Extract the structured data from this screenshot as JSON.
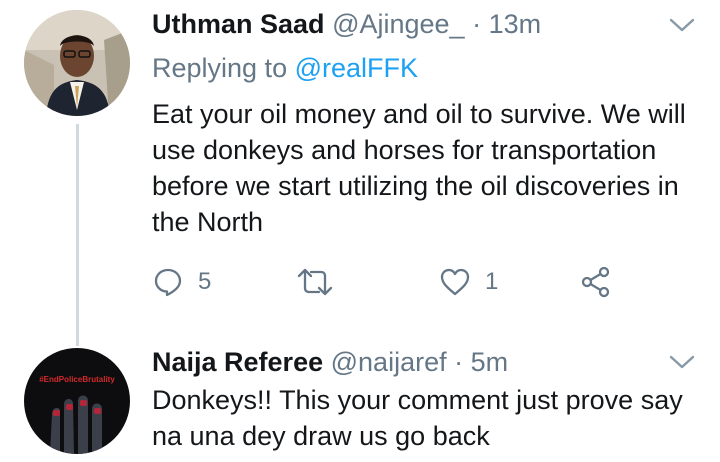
{
  "tweets": [
    {
      "name": "Uthman Saad",
      "handle": "@Ajingee_",
      "separator": "·",
      "time": "13m",
      "replying_label": "Replying to",
      "replying_to": "@realFFK",
      "text": "Eat your oil money and oil to survive. We will use donkeys and horses for transportation before we start utilizing the oil discoveries in the North",
      "actions": {
        "replies": "5",
        "retweets": "",
        "likes": "1"
      },
      "icons": {
        "reply": "reply-icon",
        "retweet": "retweet-icon",
        "like": "heart-icon",
        "share": "share-icon",
        "menu": "chevron-down-icon"
      }
    },
    {
      "name": "Naija Referee",
      "handle": "@naijaref",
      "separator": "·",
      "time": "5m",
      "text": "Donkeys!! This your comment just prove say na una dey draw us go back",
      "avatar_caption": "#EndPoliceBrutality"
    }
  ],
  "colors": {
    "secondary_text": "#657786",
    "link": "#1da1f2",
    "thread_line": "#cfd9de"
  }
}
